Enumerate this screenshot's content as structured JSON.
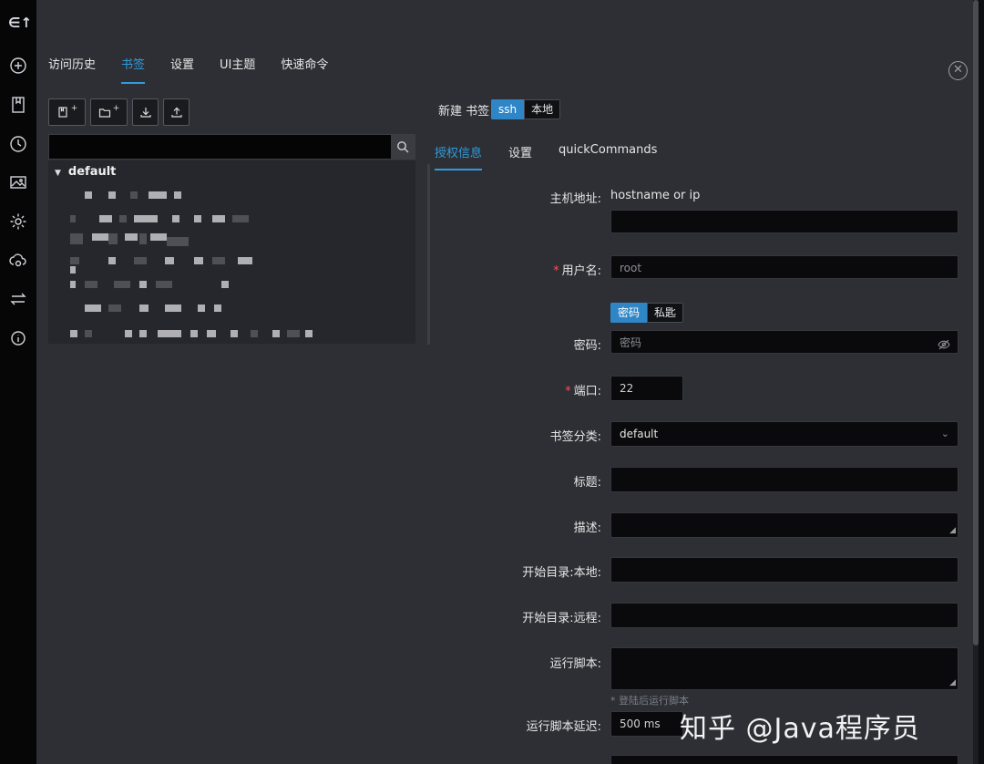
{
  "sidebar": {
    "logo": "∈↑",
    "icons": [
      "add-icon",
      "bookmark-icon",
      "history-icon",
      "image-icon",
      "gear-icon",
      "cloud-sync-icon",
      "transfer-icon",
      "info-icon"
    ]
  },
  "top_tabs": [
    "访问历史",
    "书签",
    "设置",
    "UI主题",
    "快速命令"
  ],
  "top_tabs_active": "书签",
  "toolbar": {
    "new_bookmark_plus": "+",
    "new_folder_plus": "+"
  },
  "tree": {
    "group": "default"
  },
  "new_bookmark": {
    "label": "新建 书签",
    "ssh": "ssh",
    "local": "本地"
  },
  "sub_tabs": [
    "授权信息",
    "设置",
    "quickCommands"
  ],
  "form": {
    "host_label": "主机地址:",
    "host_placeholder": "hostname or ip",
    "user_label": "用户名:",
    "user_value": "root",
    "auth_password": "密码",
    "auth_key": "私匙",
    "password_label": "密码:",
    "password_placeholder": "密码",
    "port_label": "端口:",
    "port_value": "22",
    "category_label": "书签分类:",
    "category_value": "default",
    "title_label": "标题:",
    "desc_label": "描述:",
    "local_dir_label": "开始目录:本地:",
    "remote_dir_label": "开始目录:远程:",
    "script_label": "运行脚本:",
    "script_hint": "* 登陆后运行脚本",
    "script_delay_label": "运行脚本延迟:",
    "script_delay_value": "500 ms"
  },
  "watermark": "知乎 @Java程序员",
  "colors": {
    "accent": "#2f9bdd",
    "panel": "#2d2f35",
    "required": "#ff4d4f"
  }
}
